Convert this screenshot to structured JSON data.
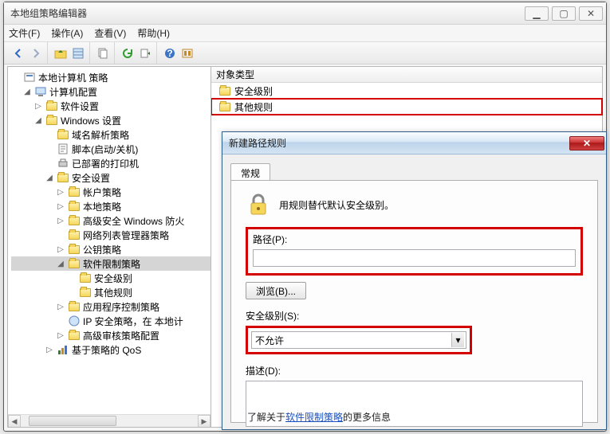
{
  "window": {
    "title": "本地组策略编辑器"
  },
  "win_buttons": {
    "min_glyph": "▁",
    "max_glyph": "▢",
    "close_glyph": "✕"
  },
  "menubar": [
    "文件(F)",
    "操作(A)",
    "查看(V)",
    "帮助(H)"
  ],
  "tree": {
    "root": "本地计算机 策略",
    "computer_config": "计算机配置",
    "software_settings": "软件设置",
    "windows_settings": "Windows 设置",
    "dns_policy": "域名解析策略",
    "script": "脚本(启动/关机)",
    "deployed_printers": "已部署的打印机",
    "security_settings": "安全设置",
    "account_policy": "帐户策略",
    "local_policy": "本地策略",
    "adv_firewall": "高级安全 Windows 防火",
    "nlm_policy": "网络列表管理器策略",
    "pubkey_policy": "公钥策略",
    "srp": "软件限制策略",
    "security_levels": "安全级别",
    "other_rules": "其他规则",
    "app_control": "应用程序控制策略",
    "ipsec": "IP 安全策略，在 本地计",
    "adv_audit": "高级审核策略配置",
    "qos": "基于策略的 QoS"
  },
  "right": {
    "header": "对象类型",
    "items": [
      "安全级别",
      "其他规则"
    ]
  },
  "dialog": {
    "title": "新建路径规则",
    "tab": "常规",
    "info": "用规则替代默认安全级别。",
    "path_label": "路径(P):",
    "path_value": "",
    "browse": "浏览(B)...",
    "level_label": "安全级别(S):",
    "level_value": "不允许",
    "desc_label": "描述(D):",
    "desc_value": "",
    "linkinfo_pre": "了解关于",
    "linkinfo_link": "软件限制策略",
    "linkinfo_post": "的更多信息",
    "close_glyph": "✕"
  }
}
